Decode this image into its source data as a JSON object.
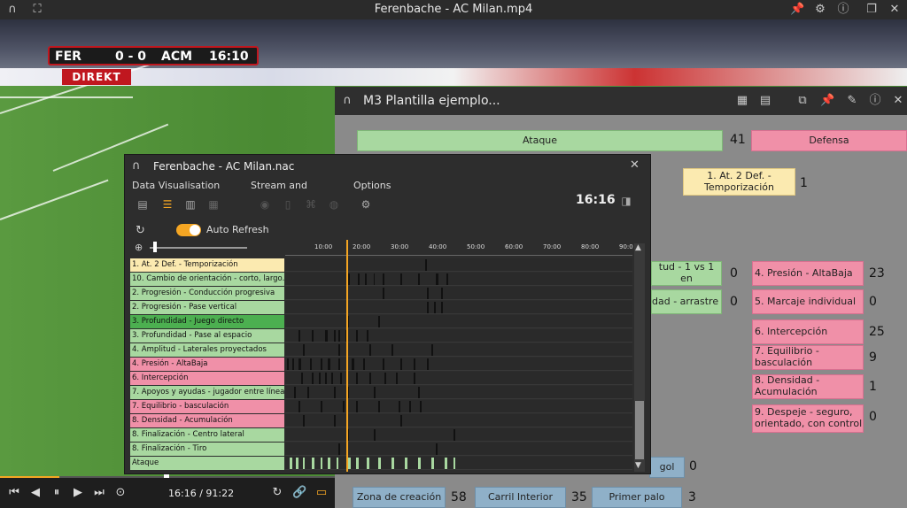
{
  "video": {
    "title": "Ferenbache - AC Milan.mp4",
    "score": {
      "home": "FER",
      "score": "0 - 0",
      "away": "ACM",
      "clock": "16:10"
    },
    "live_label": "DIREKT",
    "time_display": "16:16 / 91:22",
    "progress": 0.176
  },
  "m3": {
    "title": "M3 Plantilla ejemplo...",
    "ataque": {
      "label": "Ataque",
      "count": "41"
    },
    "defensa": {
      "label": "Defensa"
    },
    "temporizacion": {
      "label": "1. At.  2 Def. - Temporización",
      "count": "1"
    },
    "left_partial": [
      {
        "label": "tud - 1 vs 1 en",
        "count": "0"
      },
      {
        "label": "dad - arrastre",
        "count": "0"
      }
    ],
    "defense_buttons": [
      {
        "label": "4. Presión - AltaBaja",
        "count": "23"
      },
      {
        "label": "5. Marcaje individual",
        "count": "0"
      },
      {
        "label": "6. Intercepción",
        "count": "25"
      },
      {
        "label": "7. Equilibrio - basculación",
        "count": "9"
      },
      {
        "label": "8. Densidad - Acumulación",
        "count": "1"
      },
      {
        "label": "9. Despeje - seguro, orientado, con control",
        "count": "0"
      }
    ],
    "gol": {
      "label": "gol",
      "count": "0"
    },
    "bottom_buttons": [
      {
        "label": "Zona de creación",
        "count": "58"
      },
      {
        "label": "Carril Interior",
        "count": "35"
      },
      {
        "label": "Primer palo",
        "count": "3"
      }
    ]
  },
  "nac": {
    "title": "Ferenbache - AC Milan.nac",
    "menus": [
      "Data Visualisation",
      "Stream and",
      "Options"
    ],
    "clock": "16:16",
    "auto_refresh": "Auto Refresh",
    "ticks": [
      "10:00",
      "20:00",
      "30:00",
      "40:00",
      "50:00",
      "60:00",
      "70:00",
      "80:00",
      "90:0"
    ],
    "rows": [
      {
        "label": "1. At.  2 Def. - Temporización",
        "color": "#fbeab0"
      },
      {
        "label": "10. Cambio de orientación - corto, largo...",
        "color": "#a8d8a0"
      },
      {
        "label": "2. Progresión - Conducción progresiva",
        "color": "#a8d8a0"
      },
      {
        "label": "2. Progresión - Pase vertical",
        "color": "#a8d8a0"
      },
      {
        "label": "3. Profundidad - Juego directo",
        "color": "#4caf50"
      },
      {
        "label": "3. Profundidad - Pase al espacio",
        "color": "#a8d8a0"
      },
      {
        "label": "4. Amplitud - Laterales proyectados",
        "color": "#a8d8a0"
      },
      {
        "label": "4. Presión - AltaBaja",
        "color": "#f090a8"
      },
      {
        "label": "6. Intercepción",
        "color": "#f090a8"
      },
      {
        "label": "7. Apoyos y ayudas - jugador entre línea...",
        "color": "#a8d8a0"
      },
      {
        "label": "7. Equilibrio - basculación",
        "color": "#f090a8"
      },
      {
        "label": "8. Densidad - Acumulación",
        "color": "#f090a8"
      },
      {
        "label": "8. Finalización - Centro lateral",
        "color": "#a8d8a0"
      },
      {
        "label": "8. Finalización - Tiro",
        "color": "#a8d8a0"
      },
      {
        "label": "Ataque",
        "color": "#a8d8a0"
      }
    ]
  }
}
